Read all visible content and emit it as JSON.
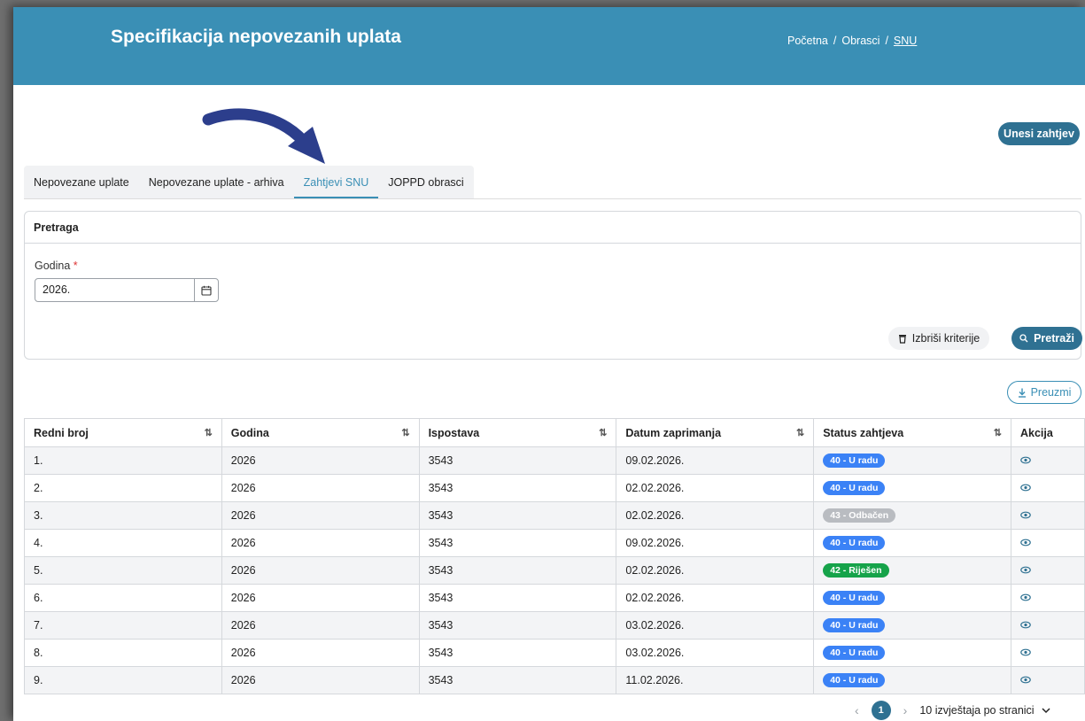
{
  "header": {
    "title": "Specifikacija nepovezanih uplata",
    "breadcrumb": [
      "Početna",
      "/",
      "Obrasci",
      "/",
      "SNU"
    ]
  },
  "actions": {
    "new_request": "Unesi zahtjev"
  },
  "tabs": [
    {
      "label": "Nepovezane uplate",
      "active": false
    },
    {
      "label": "Nepovezane uplate - arhiva",
      "active": false
    },
    {
      "label": "Zahtjevi SNU",
      "active": true
    },
    {
      "label": "JOPPD obrasci",
      "active": false
    }
  ],
  "search": {
    "title": "Pretraga",
    "year_label": "Godina",
    "required_mark": "*",
    "year_value": "2026.",
    "clear_label": "Izbriši kriterije",
    "search_label": "Pretraži"
  },
  "download_label": "Preuzmi",
  "table": {
    "columns": [
      "Redni broj",
      "Godina",
      "Ispostava",
      "Datum zaprimanja",
      "Status zahtjeva",
      "Akcija"
    ],
    "rows": [
      {
        "no": "1.",
        "year": "2026",
        "office": "3543",
        "date": "09.02.2026.",
        "status": "40 - U radu",
        "status_color": "#3b82f6"
      },
      {
        "no": "2.",
        "year": "2026",
        "office": "3543",
        "date": "02.02.2026.",
        "status": "40 - U radu",
        "status_color": "#3b82f6"
      },
      {
        "no": "3.",
        "year": "2026",
        "office": "3543",
        "date": "02.02.2026.",
        "status": "43 - Odbačen",
        "status_color": "#b9bcc1"
      },
      {
        "no": "4.",
        "year": "2026",
        "office": "3543",
        "date": "09.02.2026.",
        "status": "40 - U radu",
        "status_color": "#3b82f6"
      },
      {
        "no": "5.",
        "year": "2026",
        "office": "3543",
        "date": "02.02.2026.",
        "status": "42 - Riješen",
        "status_color": "#16a34a"
      },
      {
        "no": "6.",
        "year": "2026",
        "office": "3543",
        "date": "02.02.2026.",
        "status": "40 - U radu",
        "status_color": "#3b82f6"
      },
      {
        "no": "7.",
        "year": "2026",
        "office": "3543",
        "date": "03.02.2026.",
        "status": "40 - U radu",
        "status_color": "#3b82f6"
      },
      {
        "no": "8.",
        "year": "2026",
        "office": "3543",
        "date": "03.02.2026.",
        "status": "40 - U radu",
        "status_color": "#3b82f6"
      },
      {
        "no": "9.",
        "year": "2026",
        "office": "3543",
        "date": "11.02.2026.",
        "status": "40 - U radu",
        "status_color": "#3b82f6"
      }
    ]
  },
  "pagination": {
    "current_page": "1",
    "per_page_label": "10 izvještaja po stranici"
  },
  "colors": {
    "header_bg": "#3a8fb5",
    "primary": "#2f7192"
  }
}
